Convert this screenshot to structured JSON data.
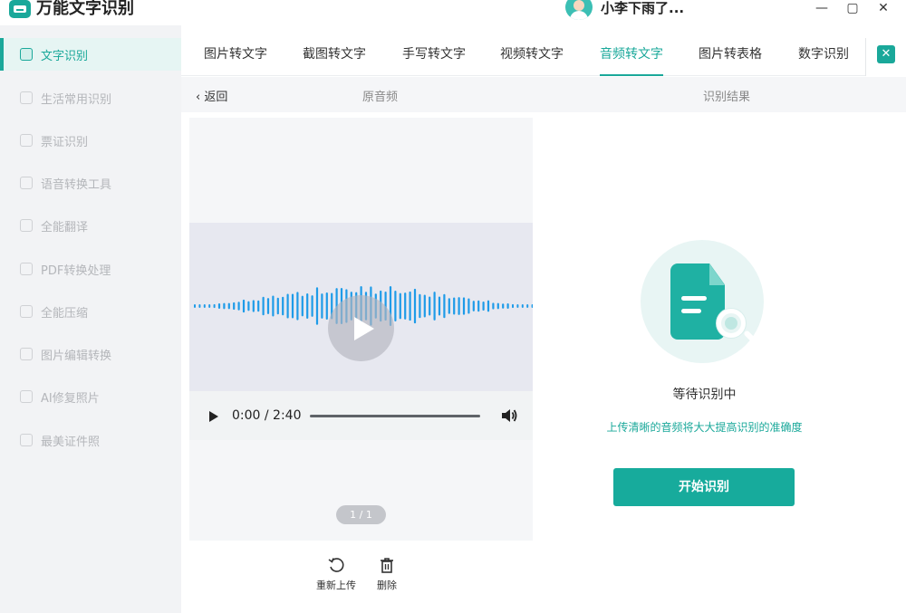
{
  "app": {
    "title": "万能文字识别",
    "user_name": "小李下雨了..."
  },
  "window_controls": {
    "minimize": "—",
    "maximize": "▢",
    "close": "✕"
  },
  "sidebar": {
    "items": [
      {
        "label": "文字识别",
        "icon": "text-scan-icon",
        "active": true
      },
      {
        "label": "生活常用识别",
        "icon": "life-scan-icon"
      },
      {
        "label": "票证识别",
        "icon": "ticket-scan-icon"
      },
      {
        "label": "语音转换工具",
        "icon": "voice-convert-icon"
      },
      {
        "label": "全能翻译",
        "icon": "translate-icon"
      },
      {
        "label": "PDF转换处理",
        "icon": "pdf-icon"
      },
      {
        "label": "全能压缩",
        "icon": "compress-icon"
      },
      {
        "label": "图片编辑转换",
        "icon": "image-edit-icon"
      },
      {
        "label": "AI修复照片",
        "icon": "ai-repair-icon"
      },
      {
        "label": "最美证件照",
        "icon": "id-photo-icon"
      }
    ]
  },
  "tabs": [
    {
      "label": "图片转文字"
    },
    {
      "label": "截图转文字"
    },
    {
      "label": "手写转文字"
    },
    {
      "label": "视频转文字"
    },
    {
      "label": "音频转文字",
      "active": true
    },
    {
      "label": "图片转表格"
    },
    {
      "label": "数字识别"
    }
  ],
  "tab_close": "✕",
  "subheader": {
    "back": "返回",
    "left_title": "原音频",
    "right_title": "识别结果"
  },
  "audio": {
    "time": "0:00 / 2:40",
    "page": "1 / 1"
  },
  "actions": {
    "reupload": "重新上传",
    "delete": "删除"
  },
  "result": {
    "status": "等待识别中",
    "hint": "上传清晰的音频将大大提高识别的准确度",
    "start_button": "开始识别"
  },
  "colors": {
    "accent": "#1aa89a",
    "wave": "#1e9be8"
  }
}
